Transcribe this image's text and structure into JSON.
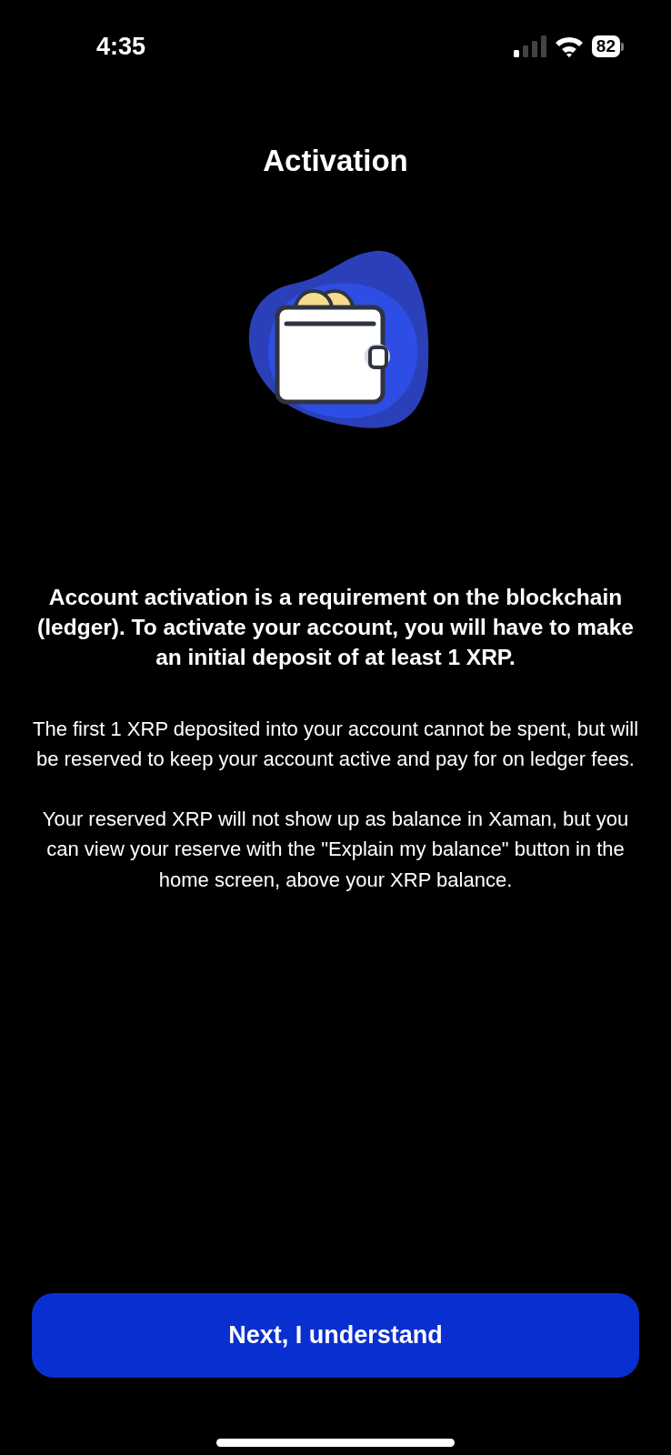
{
  "status_bar": {
    "time": "4:35",
    "battery": "82"
  },
  "title": "Activation",
  "illustration": {
    "kind": "wallet"
  },
  "intro": "Account activation is a requirement on the blockchain (ledger). To activate your account, you will have to make an initial deposit of at least 1 XRP.",
  "paragraphs": [
    "The first 1 XRP deposited into your account cannot be spent, but will be reserved to keep your account active and pay for on ledger fees.",
    "Your reserved XRP will not show up as balance in Xaman, but you can view your reserve with the \"Explain my balance\" button in the home screen, above your XRP balance."
  ],
  "button": "Next, I understand"
}
